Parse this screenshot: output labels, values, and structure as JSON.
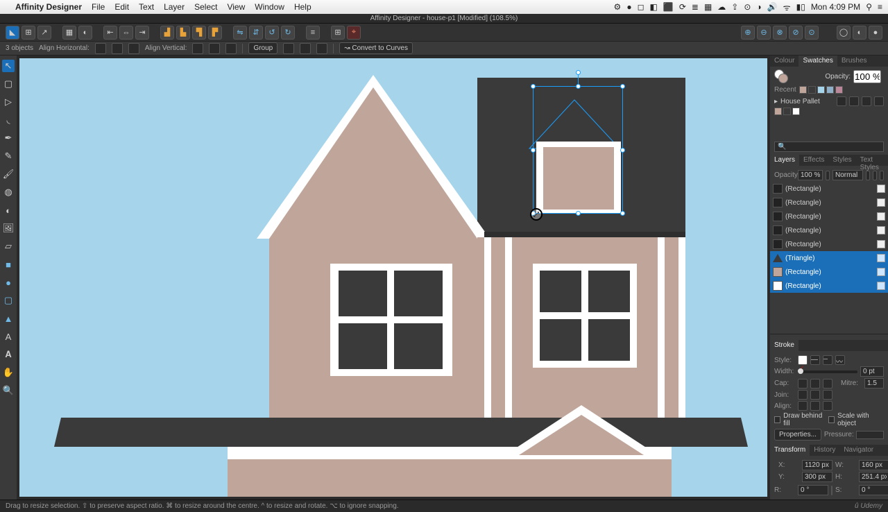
{
  "menubar": {
    "app": "Affinity Designer",
    "items": [
      "File",
      "Edit",
      "Text",
      "Layer",
      "Select",
      "View",
      "Window",
      "Help"
    ],
    "clock": "Mon 4:09 PM"
  },
  "titlebar": "Affinity Designer - house-p1 [Modified] (108.5%)",
  "context": {
    "objects": "3 objects",
    "align_h": "Align Horizontal:",
    "align_v": "Align Vertical:",
    "group": "Group",
    "convert": "Convert to Curves"
  },
  "right": {
    "tabs_color": [
      "Colour",
      "Swatches",
      "Brushes"
    ],
    "opacity_label": "Opacity:",
    "opacity_value": "100 %",
    "recent_label": "Recent",
    "palette_name": "House Pallet",
    "tabs_layers": [
      "Layers",
      "Effects",
      "Styles",
      "Text Styles"
    ],
    "layer_opacity_label": "Opacity:",
    "layer_opacity_value": "100 %",
    "blend_mode": "Normal",
    "layers": [
      {
        "name": "(Rectangle)",
        "sel": false
      },
      {
        "name": "(Rectangle)",
        "sel": false
      },
      {
        "name": "(Rectangle)",
        "sel": false
      },
      {
        "name": "(Rectangle)",
        "sel": false
      },
      {
        "name": "(Rectangle)",
        "sel": false
      },
      {
        "name": "(Triangle)",
        "sel": true,
        "tri": true
      },
      {
        "name": "(Rectangle)",
        "sel": true
      },
      {
        "name": "(Rectangle)",
        "sel": true
      }
    ],
    "stroke_label": "Stroke",
    "style_label": "Style:",
    "width_label": "Width:",
    "width_value": "0 pt",
    "cap_label": "Cap:",
    "join_label": "Join:",
    "align_label": "Align:",
    "mitre_label": "Mitre:",
    "mitre_value": "1.5",
    "draw_behind": "Draw behind fill",
    "scale_obj": "Scale with object",
    "properties": "Properties...",
    "pressure": "Pressure:",
    "tabs_transform": [
      "Transform",
      "History",
      "Navigator"
    ],
    "x_label": "X:",
    "x_val": "1120 px",
    "y_label": "Y:",
    "y_val": "300 px",
    "w_label": "W:",
    "w_val": "160 px",
    "h_label": "H:",
    "h_val": "251.4 px",
    "r_label": "R:",
    "r_val": "0 °",
    "s_label": "S:",
    "s_val": "0 °"
  },
  "status": {
    "hint": "Drag to resize selection. ⇧ to preserve aspect ratio. ⌘ to resize around the centre. ^ to resize and rotate. ⌥ to ignore snapping.",
    "brand": "Udemy"
  },
  "colors": {
    "sky": "#a5d4eb",
    "wall": "#c0a59a",
    "roof": "#3a3a3a",
    "white": "#ffffff"
  }
}
